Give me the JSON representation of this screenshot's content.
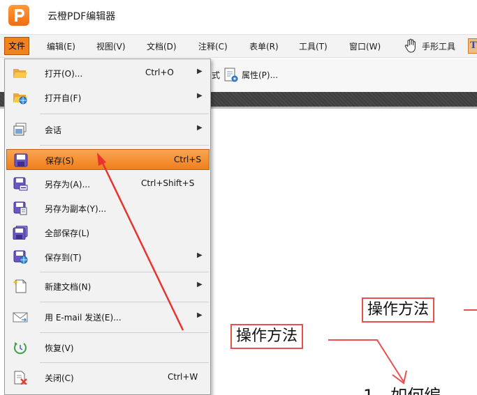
{
  "app": {
    "title": "云橙PDF编辑器"
  },
  "menubar": {
    "items": [
      "文件",
      "编辑(E)",
      "视图(V)",
      "文档(D)",
      "注释(C)",
      "表单(R)",
      "工具(T)",
      "窗口(W)"
    ],
    "hand_tool": "手形工具"
  },
  "toolbar": {
    "style_fragment": "式",
    "properties": "属性(P)..."
  },
  "file_menu": {
    "open": {
      "label": "打开(O)...",
      "shortcut": "Ctrl+O"
    },
    "open_from": {
      "label": "打开自(F)"
    },
    "session": {
      "label": "会话"
    },
    "save": {
      "label": "保存(S)",
      "shortcut": "Ctrl+S"
    },
    "save_as": {
      "label": "另存为(A)...",
      "shortcut": "Ctrl+Shift+S"
    },
    "save_copy": {
      "label": "另存为副本(Y)..."
    },
    "save_all": {
      "label": "全部保存(L)"
    },
    "save_to": {
      "label": "保存到(T)"
    },
    "new_doc": {
      "label": "新建文档(N)"
    },
    "email": {
      "label": "用 E-mail 发送(E)..."
    },
    "restore": {
      "label": "恢复(V)"
    },
    "close": {
      "label": "关闭(C)",
      "shortcut": "Ctrl+W"
    }
  },
  "document": {
    "annotation_1": "操作方法",
    "annotation_2": "操作方法",
    "heading_fragment": "1、如何编"
  },
  "colors": {
    "accent": "#f0831e",
    "annotation": "#ea4e4e",
    "arrow": "#e8332f"
  }
}
